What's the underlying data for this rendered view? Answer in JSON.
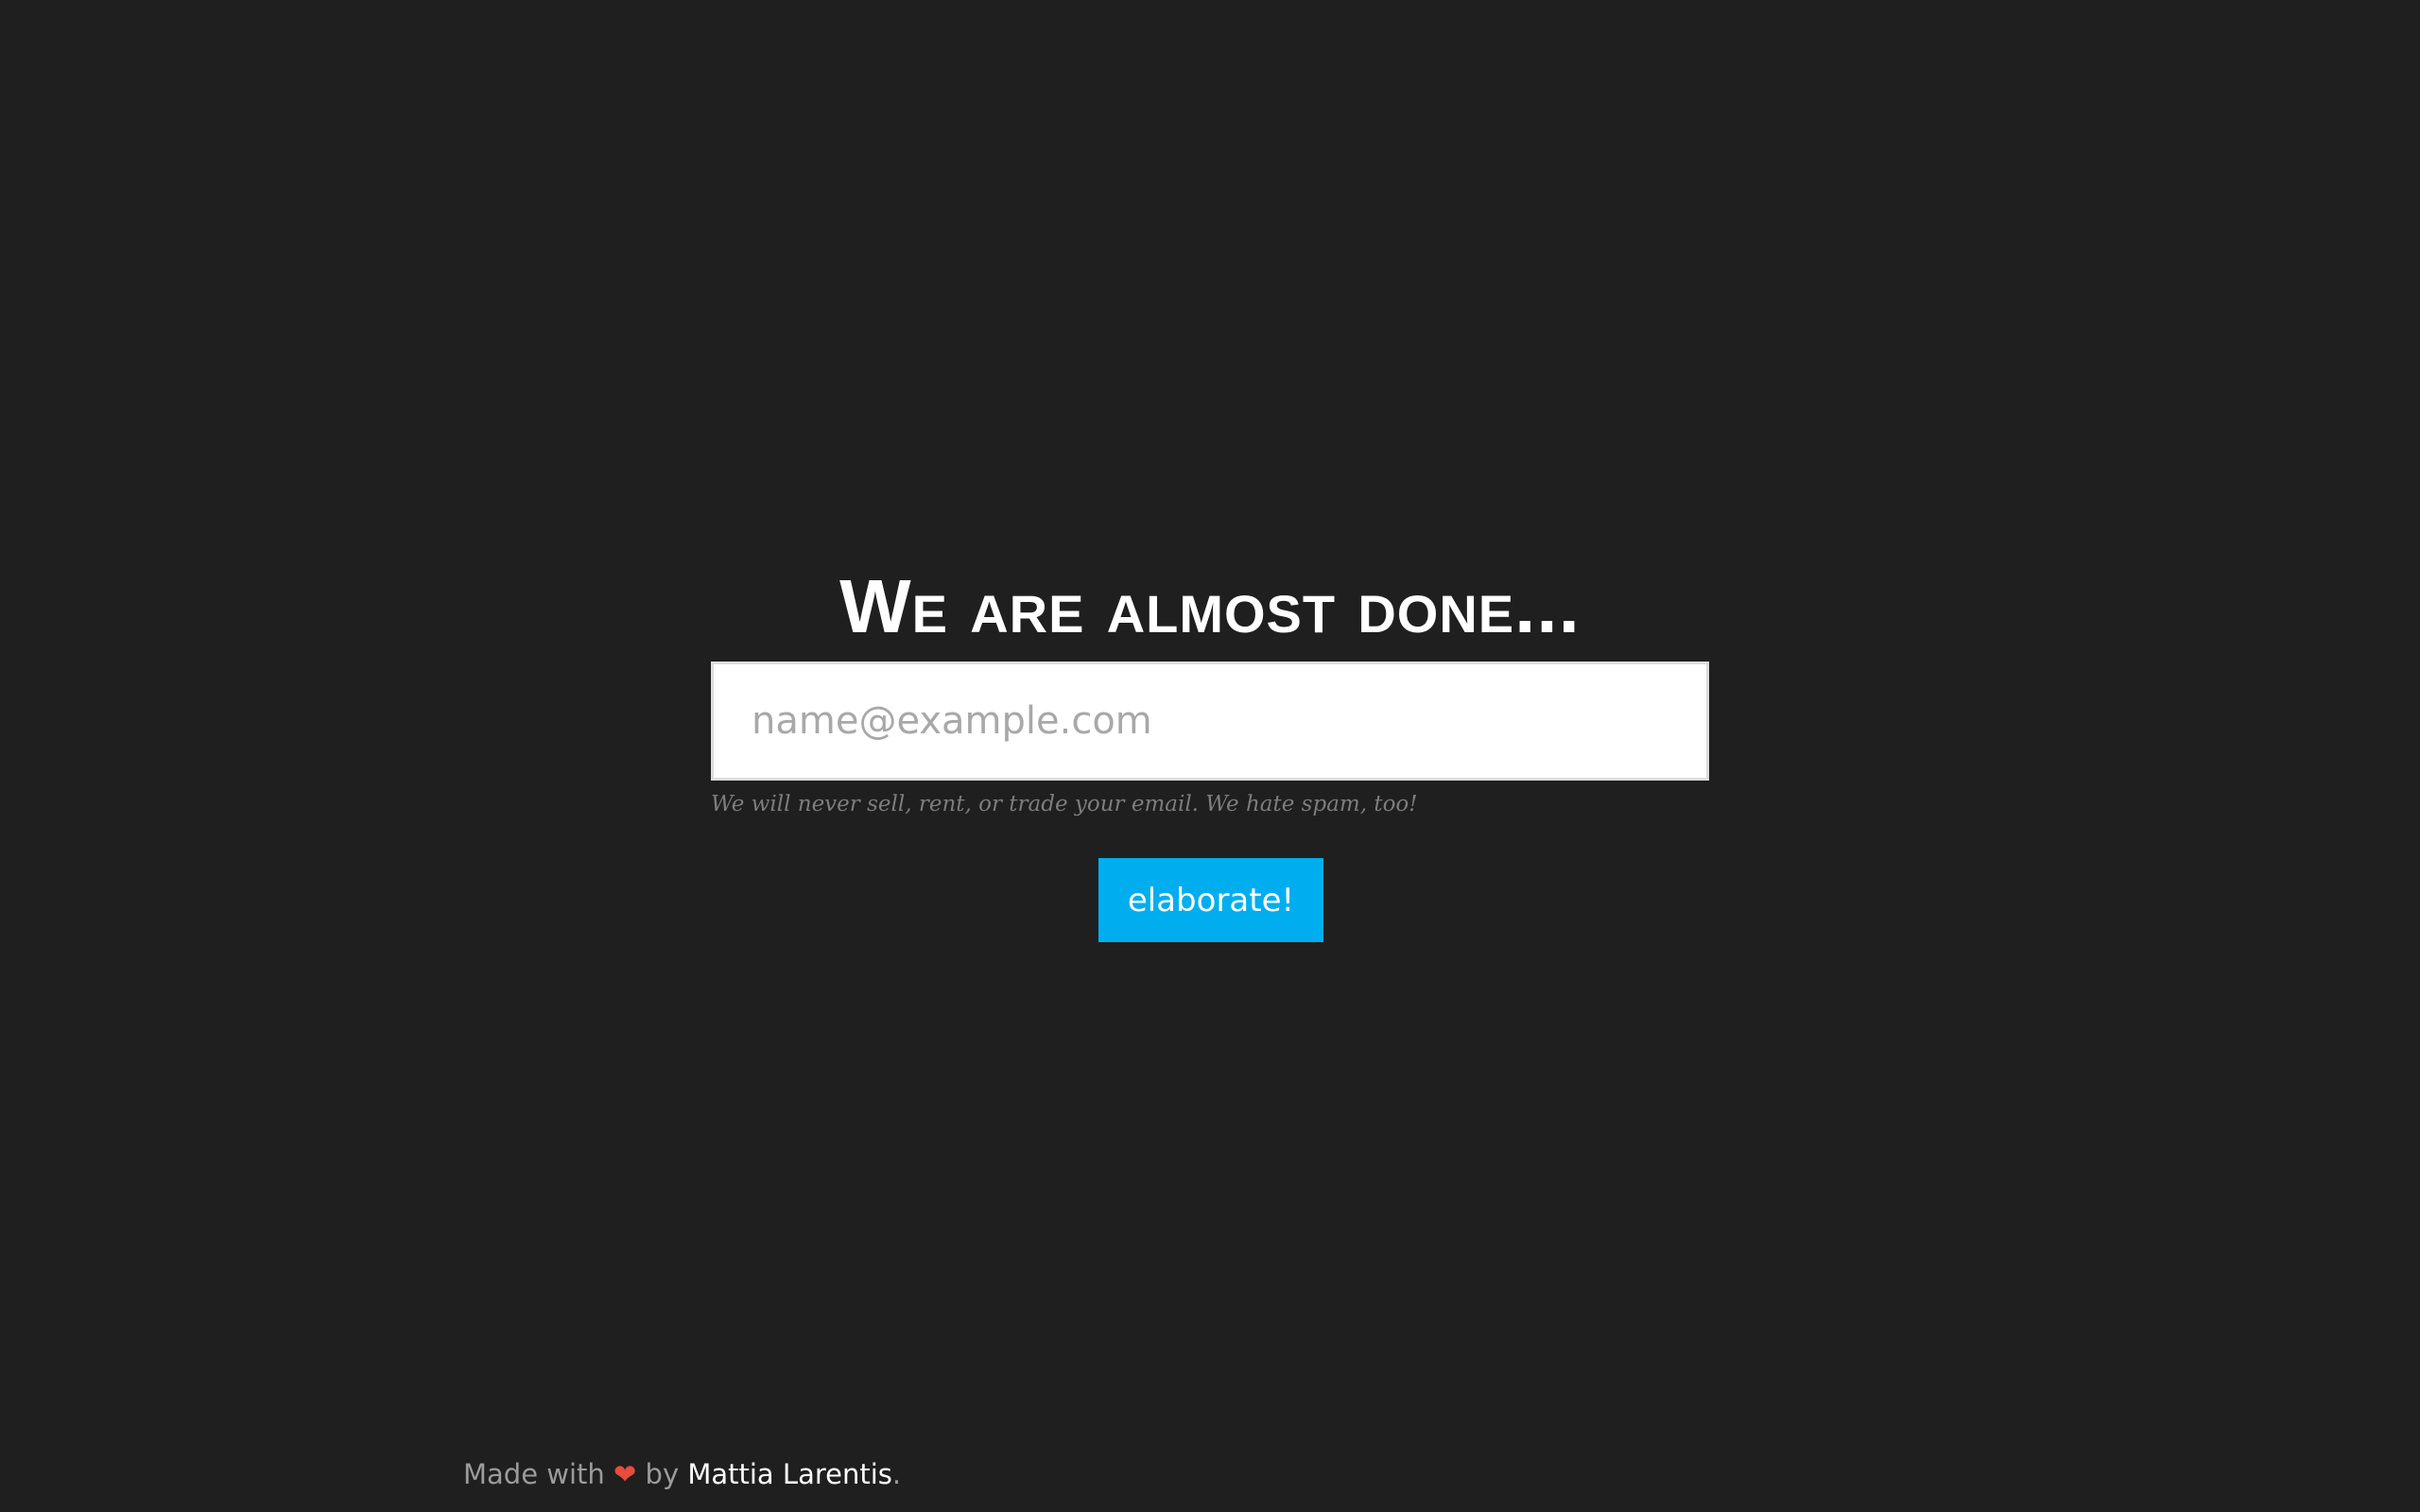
{
  "signup": {
    "heading": "We are almost done...",
    "email_placeholder": "name@example.com",
    "email_value": "",
    "disclaimer": "We will never sell, rent, or trade your email. We hate spam, too!",
    "submit_label": "elaborate!"
  },
  "footer": {
    "made_with": "Made with ",
    "heart_glyph": "❤",
    "by": " by ",
    "author": "Mattia Larentis",
    "period": "."
  },
  "colors": {
    "background": "#1f1f1f",
    "button": "#00aeef",
    "heart": "#e74c3c"
  },
  "icons": {
    "heart": "heart-icon"
  }
}
